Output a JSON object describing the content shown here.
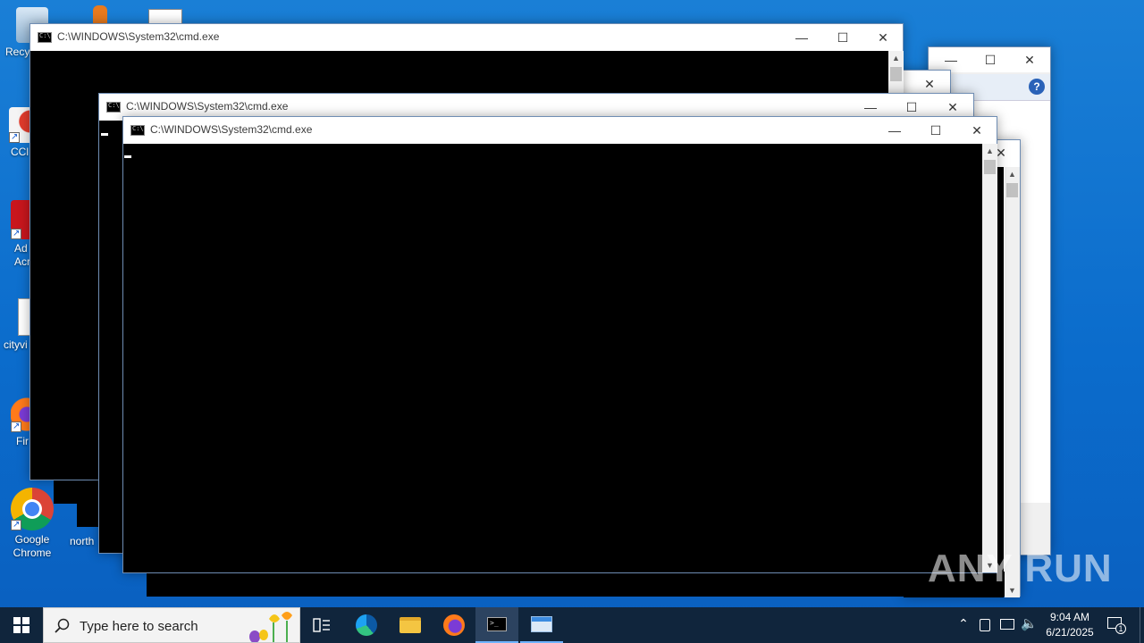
{
  "desktop": {
    "icons": [
      {
        "label": "Recy"
      },
      {
        "label": "CCl"
      },
      {
        "label": "Ad Acr"
      },
      {
        "label": "cityvi"
      },
      {
        "label": "Fir"
      },
      {
        "label": "Google Chrome"
      },
      {
        "label": "north"
      }
    ]
  },
  "windows": {
    "cmd_back": {
      "title": "C:\\WINDOWS\\System32\\cmd.exe"
    },
    "cmd_mid": {
      "title": "C:\\WINDOWS\\System32\\cmd.exe"
    },
    "cmd_front": {
      "title": "C:\\WINDOWS\\System32\\cmd.exe"
    }
  },
  "captions": {
    "minimize": "—",
    "maximize": "☐",
    "close": "✕"
  },
  "taskbar": {
    "search_placeholder": "Type here to search",
    "time": "9:04 AM",
    "date": "6/21/2025",
    "notification_count": "1"
  },
  "watermark": {
    "text": "ANY RUN"
  }
}
